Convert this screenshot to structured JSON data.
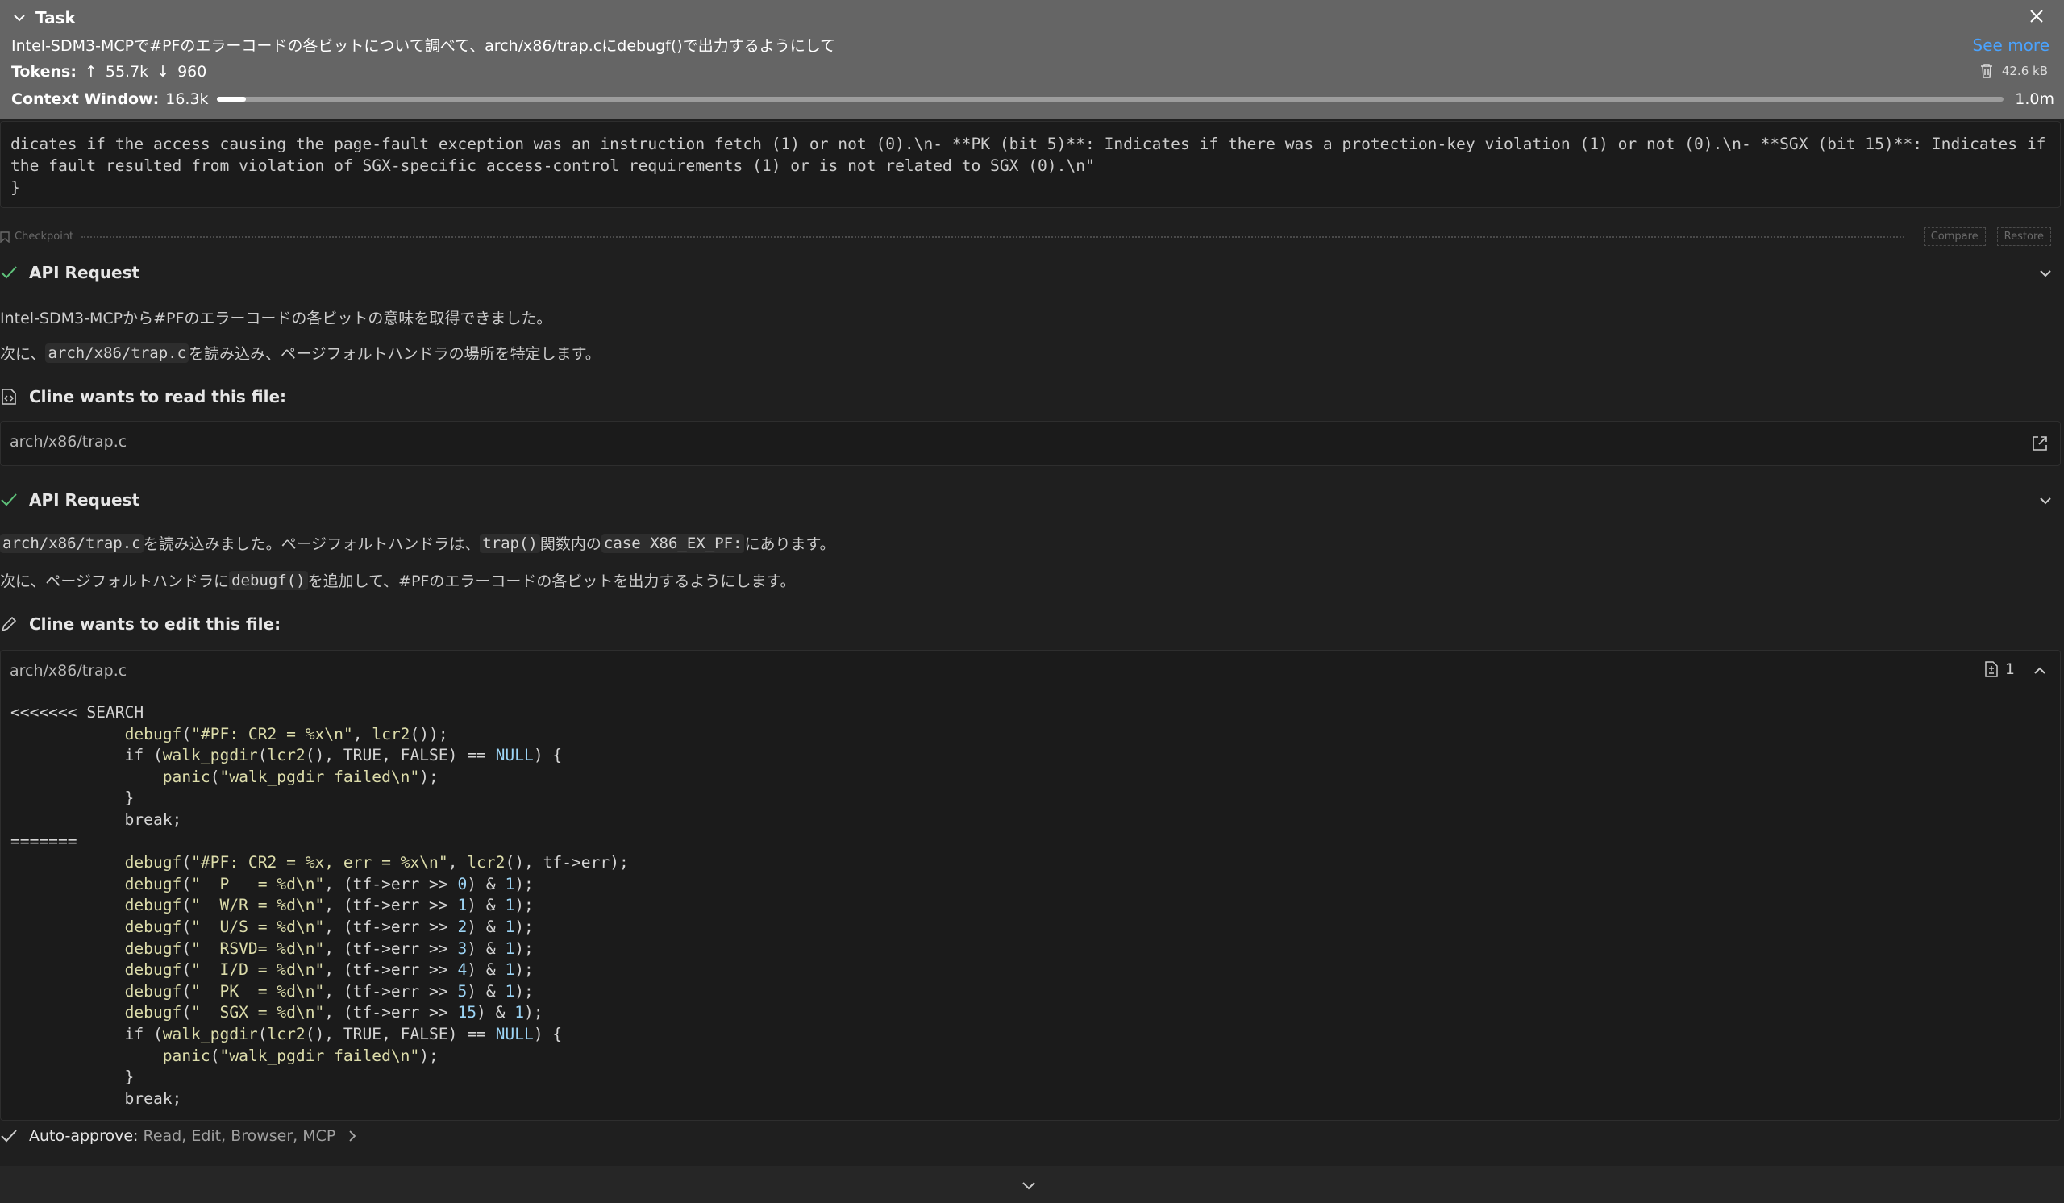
{
  "task": {
    "title": "Task",
    "description": "Intel-SDM3-MCPで#PFのエラーコードの各ビットについて調べて、arch/x86/trap.cにdebugf()で出力するようにして",
    "see_more": "See more",
    "tokens_label": "Tokens:",
    "tokens_up": "55.7k",
    "tokens_down": "960",
    "size": "42.6 kB",
    "context_label": "Context Window:",
    "context_used": "16.3k",
    "context_max": "1.0m",
    "context_fraction": 0.0163
  },
  "result_text": "dicates if the access causing the page-fault exception was an instruction fetch (1) or not (0).\\n- **PK (bit 5)**: Indicates if there was a protection-key violation (1) or not (0).\\n- **SGX (bit 15)**: Indicates if\nthe fault resulted from violation of SGX-specific access-control requirements (1) or is not related to SGX (0).\\n\"\n}",
  "checkpoint": {
    "label": "Checkpoint",
    "compare": "Compare",
    "restore": "Restore"
  },
  "api1": {
    "title": "API Request",
    "line1": "Intel-SDM3-MCPから#PFのエラーコードの各ビットの意味を取得できました。",
    "line2_pre": "次に、",
    "line2_code": "arch/x86/trap.c",
    "line2_post": "を読み込み、ページフォルトハンドラの場所を特定します。"
  },
  "read": {
    "title": "Cline wants to read this file:",
    "path": "arch/x86/trap.c"
  },
  "api2": {
    "title": "API Request",
    "l1_code1": "arch/x86/trap.c",
    "l1_t1": "を読み込みました。ページフォルトハンドラは、",
    "l1_code2": "trap()",
    "l1_t2": "関数内の",
    "l1_code3": "case X86_EX_PF:",
    "l1_t3": "にあります。",
    "l2_pre": "次に、ページフォルトハンドラに",
    "l2_code": "debugf()",
    "l2_post": "を追加して、#PFのエラーコードの各ビットを出力するようにします。"
  },
  "edit": {
    "title": "Cline wants to edit this file:",
    "path": "arch/x86/trap.c",
    "count": "1"
  },
  "auto_approve": {
    "label": "Auto-approve:",
    "value": "Read, Edit, Browser, MCP"
  }
}
